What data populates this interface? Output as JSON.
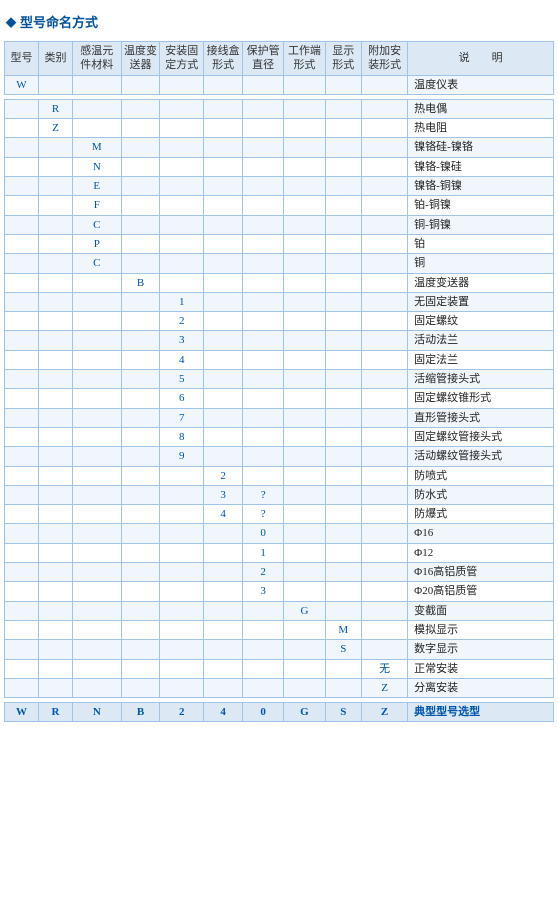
{
  "title": "型号命名方式",
  "headers": {
    "row1": [
      "型号",
      "类别",
      "感温元件材料",
      "温度变送器",
      "安装固定方式",
      "接线盒形式",
      "保护管直径",
      "工作端形式",
      "显示形式",
      "附加安装形式",
      "说　　明"
    ],
    "col_spans": [
      1,
      1,
      1,
      1,
      1,
      1,
      1,
      1,
      1,
      1,
      1
    ]
  },
  "rows": [
    {
      "cols": [
        "W",
        "",
        "",
        "",
        "",
        "",
        "",
        "",
        "",
        "",
        "温度仪表"
      ],
      "type": "main"
    },
    {
      "spacer": true
    },
    {
      "cols": [
        "",
        "R",
        "",
        "",
        "",
        "",
        "",
        "",
        "",
        "",
        "热电偶"
      ],
      "type": "sub"
    },
    {
      "cols": [
        "",
        "Z",
        "",
        "",
        "",
        "",
        "",
        "",
        "",
        "",
        "热电阻"
      ],
      "type": "sub"
    },
    {
      "cols": [
        "",
        "",
        "M",
        "",
        "",
        "",
        "",
        "",
        "",
        "",
        "镍铬硅-镍铬"
      ],
      "type": "sub"
    },
    {
      "cols": [
        "",
        "",
        "N",
        "",
        "",
        "",
        "",
        "",
        "",
        "",
        "镍铬-镍硅"
      ],
      "type": "sub"
    },
    {
      "cols": [
        "",
        "",
        "E",
        "",
        "",
        "",
        "",
        "",
        "",
        "",
        "镍铬-铜镍"
      ],
      "type": "sub"
    },
    {
      "cols": [
        "",
        "",
        "F",
        "",
        "",
        "",
        "",
        "",
        "",
        "",
        "铂-铜镍"
      ],
      "type": "sub"
    },
    {
      "cols": [
        "",
        "",
        "C",
        "",
        "",
        "",
        "",
        "",
        "",
        "",
        "铜-铜镍"
      ],
      "type": "sub"
    },
    {
      "cols": [
        "",
        "",
        "P",
        "",
        "",
        "",
        "",
        "",
        "",
        "",
        "铂"
      ],
      "type": "sub"
    },
    {
      "cols": [
        "",
        "",
        "C",
        "",
        "",
        "",
        "",
        "",
        "",
        "",
        "铜"
      ],
      "type": "sub"
    },
    {
      "cols": [
        "",
        "",
        "",
        "B",
        "",
        "",
        "",
        "",
        "",
        "",
        "温度变送器"
      ],
      "type": "sub"
    },
    {
      "cols": [
        "",
        "",
        "",
        "",
        "1",
        "",
        "",
        "",
        "",
        "",
        "无固定装置"
      ],
      "type": "sub"
    },
    {
      "cols": [
        "",
        "",
        "",
        "",
        "2",
        "",
        "",
        "",
        "",
        "",
        "固定螺纹"
      ],
      "type": "sub"
    },
    {
      "cols": [
        "",
        "",
        "",
        "",
        "3",
        "",
        "",
        "",
        "",
        "",
        "活动法兰"
      ],
      "type": "sub"
    },
    {
      "cols": [
        "",
        "",
        "",
        "",
        "4",
        "",
        "",
        "",
        "",
        "",
        "固定法兰"
      ],
      "type": "sub"
    },
    {
      "cols": [
        "",
        "",
        "",
        "",
        "5",
        "",
        "",
        "",
        "",
        "",
        "活缩管接头式"
      ],
      "type": "sub"
    },
    {
      "cols": [
        "",
        "",
        "",
        "",
        "6",
        "",
        "",
        "",
        "",
        "",
        "固定螺纹锥形式"
      ],
      "type": "sub"
    },
    {
      "cols": [
        "",
        "",
        "",
        "",
        "7",
        "",
        "",
        "",
        "",
        "",
        "直形管接头式"
      ],
      "type": "sub"
    },
    {
      "cols": [
        "",
        "",
        "",
        "",
        "8",
        "",
        "",
        "",
        "",
        "",
        "固定螺纹管接头式"
      ],
      "type": "sub"
    },
    {
      "cols": [
        "",
        "",
        "",
        "",
        "9",
        "",
        "",
        "",
        "",
        "",
        "活动螺纹管接头式"
      ],
      "type": "sub"
    },
    {
      "cols": [
        "",
        "",
        "",
        "",
        "",
        "2",
        "",
        "",
        "",
        "",
        "防喷式"
      ],
      "type": "sub"
    },
    {
      "cols": [
        "",
        "",
        "",
        "",
        "",
        "3",
        "?",
        "",
        "",
        "",
        "防水式"
      ],
      "type": "sub"
    },
    {
      "cols": [
        "",
        "",
        "",
        "",
        "",
        "4",
        "?",
        "",
        "",
        "",
        "防爆式"
      ],
      "type": "sub"
    },
    {
      "cols": [
        "",
        "",
        "",
        "",
        "",
        "",
        "0",
        "",
        "",
        "",
        "Φ16"
      ],
      "type": "sub"
    },
    {
      "cols": [
        "",
        "",
        "",
        "",
        "",
        "",
        "1",
        "",
        "",
        "",
        "Φ12"
      ],
      "type": "sub"
    },
    {
      "cols": [
        "",
        "",
        "",
        "",
        "",
        "",
        "2",
        "",
        "",
        "",
        "Φ16高铝质管"
      ],
      "type": "sub"
    },
    {
      "cols": [
        "",
        "",
        "",
        "",
        "",
        "",
        "3",
        "",
        "",
        "",
        "Φ20高铝质管"
      ],
      "type": "sub"
    },
    {
      "cols": [
        "",
        "",
        "",
        "",
        "",
        "",
        "",
        "G",
        "",
        "",
        "变截面"
      ],
      "type": "sub"
    },
    {
      "cols": [
        "",
        "",
        "",
        "",
        "",
        "",
        "",
        "",
        "M",
        "",
        "模拟显示"
      ],
      "type": "sub"
    },
    {
      "cols": [
        "",
        "",
        "",
        "",
        "",
        "",
        "",
        "",
        "S",
        "",
        "数字显示"
      ],
      "type": "sub"
    },
    {
      "cols": [
        "",
        "",
        "",
        "",
        "",
        "",
        "",
        "",
        "",
        "无",
        "正常安装"
      ],
      "type": "sub"
    },
    {
      "cols": [
        "",
        "",
        "",
        "",
        "",
        "",
        "",
        "",
        "",
        "Z",
        "分离安装"
      ],
      "type": "sub"
    },
    {
      "spacer": true
    },
    {
      "cols": [
        "W",
        "R",
        "N",
        "B",
        "2",
        "4",
        "0",
        "G",
        "S",
        "Z",
        "典型型号选型"
      ],
      "type": "example"
    }
  ]
}
